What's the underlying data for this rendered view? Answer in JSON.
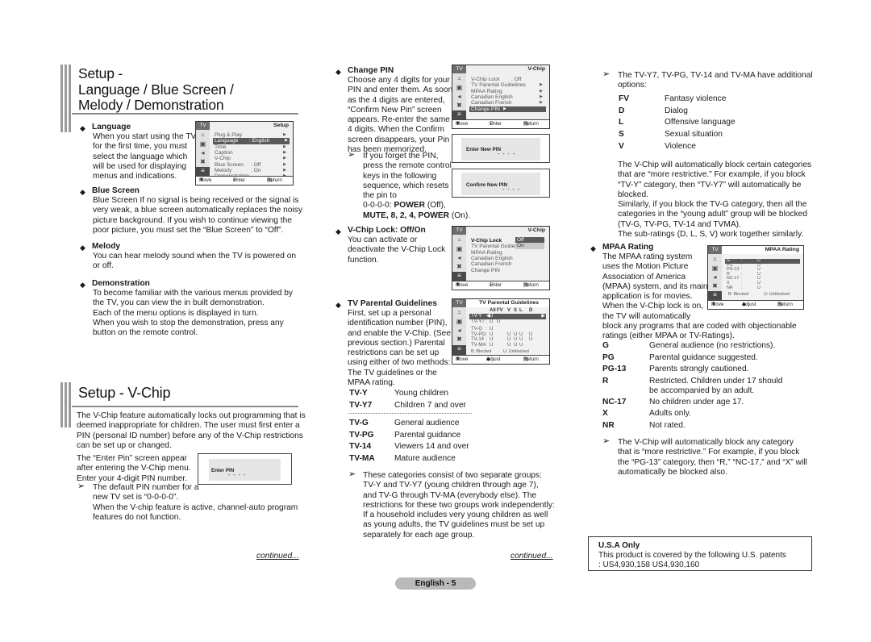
{
  "section1": {
    "title_lines": [
      "Setup -",
      "Language / Blue Screen /",
      "Melody / Demonstration"
    ],
    "language": {
      "heading": "Language",
      "lines": [
        "When you start using the TV",
        "for the first time, you must",
        "select the language which",
        "will be used for displaying",
        "menus and indications."
      ]
    },
    "blue_screen": {
      "heading": "Blue Screen",
      "lines": [
        "Blue Screen If no signal is being received or the signal is",
        "very weak, a blue screen automatically replaces the noisy",
        "picture background. If you wish to continue viewing the",
        "poor picture, you must set the “Blue Screen” to “Off”."
      ]
    },
    "melody": {
      "heading": "Melody",
      "lines": [
        "You can hear melody sound when the TV is powered on",
        "or off."
      ]
    },
    "demonstration": {
      "heading": "Demonstration",
      "lines": [
        "To become familiar with the various menus provided by",
        "the TV, you can view the in built demonstration.",
        "Each of the menu options is displayed in turn.",
        "When you wish to stop the demonstration, press any",
        "button on the remote control."
      ]
    },
    "setup_menu": {
      "tab": "TV",
      "title": "Setup",
      "items": [
        {
          "label": "Plug & Play",
          "value": "",
          "arrow": "▶"
        },
        {
          "label": "Language",
          "value": ": English",
          "arrow": "▶"
        },
        {
          "label": "Time",
          "value": "",
          "arrow": "▶"
        },
        {
          "label": "Caption",
          "value": "",
          "arrow": "▶"
        },
        {
          "label": "V-Chip",
          "value": "",
          "arrow": "▶"
        },
        {
          "label": "Blue Screen",
          "value": ": Off",
          "arrow": "▶"
        },
        {
          "label": "Melody",
          "value": ": On",
          "arrow": "▶"
        },
        {
          "label": "Demonstration",
          "value": "",
          "arrow": "▶"
        }
      ],
      "selected_index": 1,
      "footer": {
        "move": "Move",
        "enter": "Enter",
        "return": "Return"
      }
    }
  },
  "section2": {
    "title": "Setup - V-Chip",
    "intro_lines": [
      "The V-Chip feature automatically locks out programming that is",
      "deemed inappropriate for children. The user must first enter a",
      "PIN (personal ID number) before any of the V-Chip restrictions",
      "can be set up or changed."
    ],
    "enter_pin_lines": [
      "The “Enter Pin” screen appear",
      "after entering the V-Chip menu.",
      "Enter your 4-digit PIN number."
    ],
    "default_pin_lines": [
      "The default PIN number for a",
      "new TV set is “0-0-0-0”.",
      "When the V-chip feature is active, channel-auto program",
      "features do not function."
    ],
    "enter_pin_box": {
      "label": "Enter PIN",
      "dots": "- - - -"
    }
  },
  "change_pin": {
    "heading": "Change PIN",
    "lines": [
      "Choose any 4 digits for your",
      "PIN and enter them. As soon",
      "as the 4 digits are entered,",
      "“Confirm New Pin” screen",
      "appears. Re-enter the same",
      "4 digits. When the Confirm",
      "screen disappears, your Pin",
      "has been memorized."
    ],
    "note_lines": [
      "If you forget the PIN,",
      "press the remote control",
      "keys in the following",
      "sequence, which resets",
      "the pin to"
    ],
    "note_seq1": {
      "a": "0-0-0-0: ",
      "b": "POWER",
      "c": " (Off),"
    },
    "note_seq2": {
      "a": "MUTE",
      "b": ", 8, 2, 4, ",
      "c": "POWER",
      "d": " (On)."
    },
    "vchip_menu": {
      "tab": "TV",
      "title": "V-Chip",
      "items": [
        {
          "label": "V-Chip Lock",
          "value": ": Off",
          "arrow": ""
        },
        {
          "label": "TV Parental Guidelines",
          "value": "",
          "arrow": "▶"
        },
        {
          "label": "MPAA Rating",
          "value": "",
          "arrow": "▶"
        },
        {
          "label": "Canadian English",
          "value": "",
          "arrow": "▶"
        },
        {
          "label": "Canadian French",
          "value": "",
          "arrow": "▶"
        },
        {
          "label": "Change PIN",
          "value": "",
          "arrow": "▶"
        }
      ],
      "selected_index": 5,
      "footer": {
        "move": "Move",
        "enter": "Enter",
        "return": "Return"
      }
    },
    "enter_new_pin": {
      "label": "Enter New PIN",
      "dots": "- - - -"
    },
    "confirm_new_pin": {
      "label": "Confirm New PIN",
      "dots": "- - - -"
    }
  },
  "vchip_lock": {
    "heading": "V-Chip Lock: Off/On",
    "lines": [
      "You can activate or",
      "deactivate the V-Chip Lock",
      "function."
    ],
    "menu": {
      "tab": "TV",
      "title": "V-Chip",
      "items": [
        "V-Chip Lock",
        "TV Parental Guideli",
        "MPAA Rating",
        "Canadian English",
        "Canadian French",
        "Change PIN"
      ],
      "dropdown_options": [
        "Off",
        "On"
      ],
      "dropdown_selected": "Off",
      "footer": {
        "move": "Move",
        "enter": "Enter",
        "return": "Return"
      }
    }
  },
  "tv_parental": {
    "heading": "TV Parental Guidelines",
    "lines": [
      "First, set up a personal",
      "identification number (PIN),",
      "and enable the V-Chip. (See",
      "previous section.) Parental",
      "restrictions can be set up",
      "using either of two methods:",
      "The TV guidelines or the",
      "MPAA rating."
    ],
    "menu": {
      "tab": "TV",
      "title": "TV Parental Guidelines",
      "columns": [
        "All",
        "FV",
        "V",
        "S",
        "L",
        "D"
      ],
      "rows": [
        {
          "rating": "TV-Y",
          "cells": [
            "U",
            "",
            "",
            "",
            "",
            ""
          ]
        },
        {
          "rating": "TV-Y7",
          "cells": [
            "U",
            "U",
            "",
            "",
            "",
            ""
          ]
        },
        {
          "rating": "TV-G",
          "cells": [
            "U",
            "",
            "",
            "",
            "",
            ""
          ]
        },
        {
          "rating": "TV-PG",
          "cells": [
            "U",
            "",
            "U",
            "U",
            "U",
            "U"
          ]
        },
        {
          "rating": "TV-14",
          "cells": [
            "U",
            "",
            "U",
            "U",
            "U",
            "U"
          ]
        },
        {
          "rating": "TV-MA",
          "cells": [
            "U",
            "",
            "U",
            "U",
            "U",
            ""
          ]
        }
      ],
      "legend_blocked": "B: Blocked",
      "legend_unblocked": "U: Unblocked",
      "footer": {
        "move": "Move",
        "adjust": "Adjust",
        "return": "Return"
      }
    },
    "ratings_group1": [
      {
        "code": "TV-Y",
        "desc": "Young children"
      },
      {
        "code": "TV-Y7",
        "desc": "Children 7 and over"
      }
    ],
    "ratings_group2": [
      {
        "code": "TV-G",
        "desc": "General audience"
      },
      {
        "code": "TV-PG",
        "desc": "Parental guidance"
      },
      {
        "code": "TV-14",
        "desc": "Viewers 14 and over"
      },
      {
        "code": "TV-MA",
        "desc": "Mature audience"
      }
    ],
    "note_lines": [
      "These categories consist of two separate groups:",
      "TV-Y and TV-Y7 (young children through age 7),",
      "and TV-G through TV-MA (everybody else). The",
      "restrictions for these two groups work independently:",
      "If a household includes very young children as well",
      "as young adults, the TV guidelines must be set up",
      "separately for each age group."
    ]
  },
  "right_column": {
    "options_note_lines": [
      "The TV-Y7, TV-PG, TV-14 and TV-MA have additional",
      "options:"
    ],
    "options": [
      {
        "code": "FV",
        "desc": "Fantasy violence"
      },
      {
        "code": "D",
        "desc": "Dialog"
      },
      {
        "code": "L",
        "desc": "Offensive language"
      },
      {
        "code": "S",
        "desc": "Sexual situation"
      },
      {
        "code": "V",
        "desc": "Violence"
      }
    ],
    "auto_block_lines": [
      "The V-Chip will automatically block certain categories",
      "that are “more restrictive.” For example, if you block",
      "“TV-Y” category, then “TV-Y7” will automatically be",
      "blocked.",
      "Similarly, if you block the TV-G category, then all the",
      "categories in the “young adult” group will be blocked",
      "(TV-G, TV-PG, TV-14 and TVMA).",
      "The sub-ratings (D, L, S, V) work together similarly."
    ],
    "mpaa": {
      "heading": "MPAA Rating",
      "lines_narrow": [
        "The MPAA rating system",
        "uses the Motion Picture",
        "Association of America",
        "(MPAA) system, and its main",
        "application is for movies.",
        "When the V-Chip lock is on,",
        "the TV will automatically"
      ],
      "lines_wide": [
        "block any programs that are coded with objectionable",
        "ratings (either MPAA or TV-Ratings)."
      ],
      "menu": {
        "tab": "TV",
        "title": "MPAA Rating",
        "rows": [
          {
            "rating": "G",
            "value": "U"
          },
          {
            "rating": "PG",
            "value": "U"
          },
          {
            "rating": "PG-13",
            "value": "U"
          },
          {
            "rating": "R",
            "value": "U"
          },
          {
            "rating": "NC-17",
            "value": "U"
          },
          {
            "rating": "X",
            "value": "U"
          },
          {
            "rating": "NR",
            "value": "U"
          }
        ],
        "legend_blocked": "B: Blocked",
        "legend_unblocked": "U: Unblocked",
        "footer": {
          "move": "Move",
          "adjust": "Adjust",
          "return": "Return"
        }
      },
      "ratings": [
        {
          "code": "G",
          "desc": [
            "General audience (no restrictions)."
          ]
        },
        {
          "code": "PG",
          "desc": [
            "Parental guidance suggested."
          ]
        },
        {
          "code": "PG-13",
          "desc": [
            "Parents strongly cautioned."
          ]
        },
        {
          "code": "R",
          "desc": [
            "Restricted. Children under 17 should",
            "be accompanied by an adult."
          ]
        },
        {
          "code": "NC-17",
          "desc": [
            "No children under age 17."
          ]
        },
        {
          "code": "X",
          "desc": [
            "Adults only."
          ]
        },
        {
          "code": "NR",
          "desc": [
            "Not rated."
          ]
        }
      ],
      "note_lines": [
        "The V-Chip will automatically block any category",
        "that is “more restrictive.” For example, if you block",
        "the “PG-13” category, then “R,” “NC-17,” and “X” will",
        "automatically be blocked also."
      ]
    },
    "usa_box": {
      "title": "U.S.A Only",
      "line1": "This product is covered by the following U.S. patents",
      "line2": ": US4,930,158 US4,930,160"
    }
  },
  "footer": {
    "continued_left": "continued...",
    "continued_mid": "continued...",
    "page_label": "English - 5"
  },
  "icons": {
    "bullet": "◆",
    "note_arrow": "➢",
    "move": "⬍",
    "enter": "↵",
    "return": "▤",
    "adjust": "◆"
  }
}
